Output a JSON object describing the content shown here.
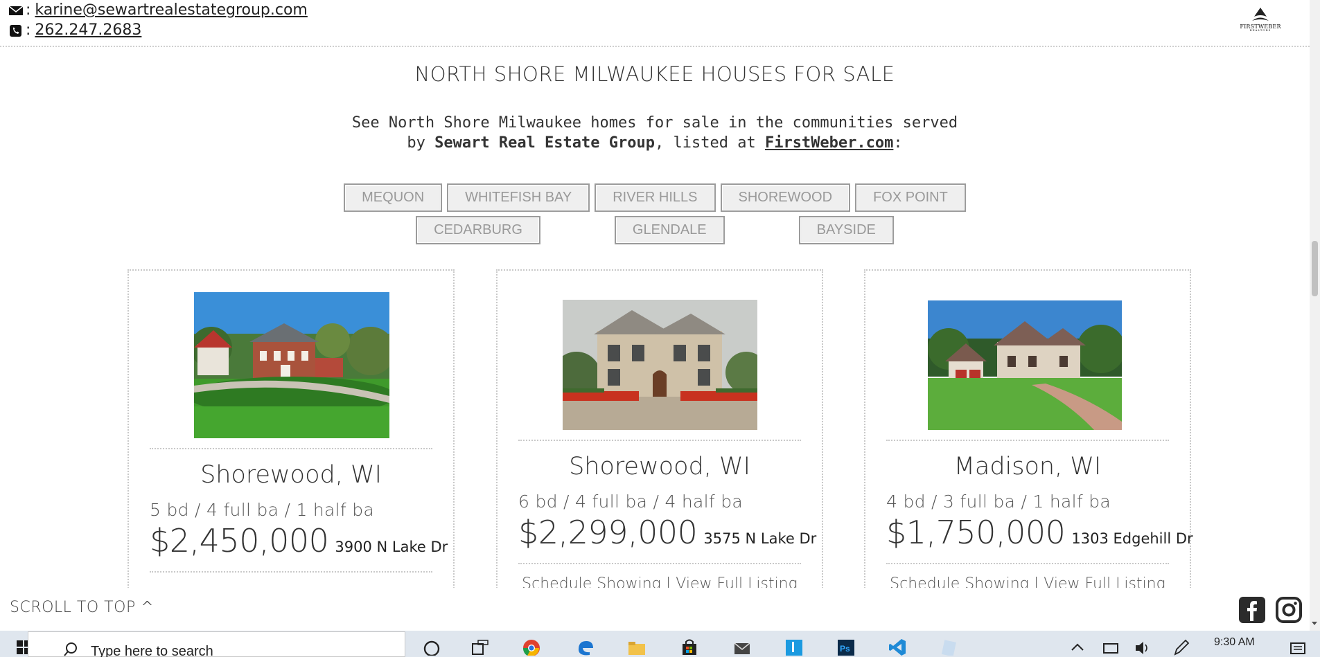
{
  "contact": {
    "email": "karine@sewartrealestategroup.com",
    "phone": "262.247.2683",
    "separator": ":"
  },
  "brand": {
    "logo_text": "FIRSTWEBER",
    "logo_subtext": "REALTORS"
  },
  "headline": "NORTH SHORE MILWAUKEE HOUSES FOR SALE",
  "intro": {
    "prefix": "See North Shore Milwaukee homes for sale in the communities served by ",
    "bold": "Sewart Real Estate Group",
    "middle": ", listed at ",
    "link": "FirstWeber.com",
    "suffix": ":"
  },
  "communities_row1": [
    "MEQUON",
    "WHITEFISH BAY",
    "RIVER HILLS",
    "SHOREWOOD",
    "FOX POINT"
  ],
  "communities_row2": [
    "CEDARBURG",
    "GLENDALE",
    "BAYSIDE"
  ],
  "listings": [
    {
      "city": "Shorewood, WI",
      "beds": "5 bd / 4 full ba / 1 half ba",
      "price": "$2,450,000",
      "address": "3900 N Lake Dr"
    },
    {
      "city": "Shorewood, WI",
      "beds": "6 bd / 4 full ba / 4 half ba",
      "price": "$2,299,000",
      "address": "3575 N Lake Dr"
    },
    {
      "city": "Madison, WI",
      "beds": "4 bd / 3 full ba / 1 half ba",
      "price": "$1,750,000",
      "address": "1303 Edgehill Dr"
    }
  ],
  "listing_links": {
    "schedule": "Schedule Showing",
    "divider": "|",
    "view": "View Full Listing"
  },
  "footer": {
    "scroll_top": "SCROLL TO TOP ^"
  },
  "taskbar": {
    "search_placeholder": "Type here to search",
    "time": "9:30 AM"
  },
  "colors": {
    "button_bg": "#efefef",
    "button_border": "#9b9b9b",
    "button_text": "#999999",
    "taskbar_bg": "#dfe6ee"
  }
}
